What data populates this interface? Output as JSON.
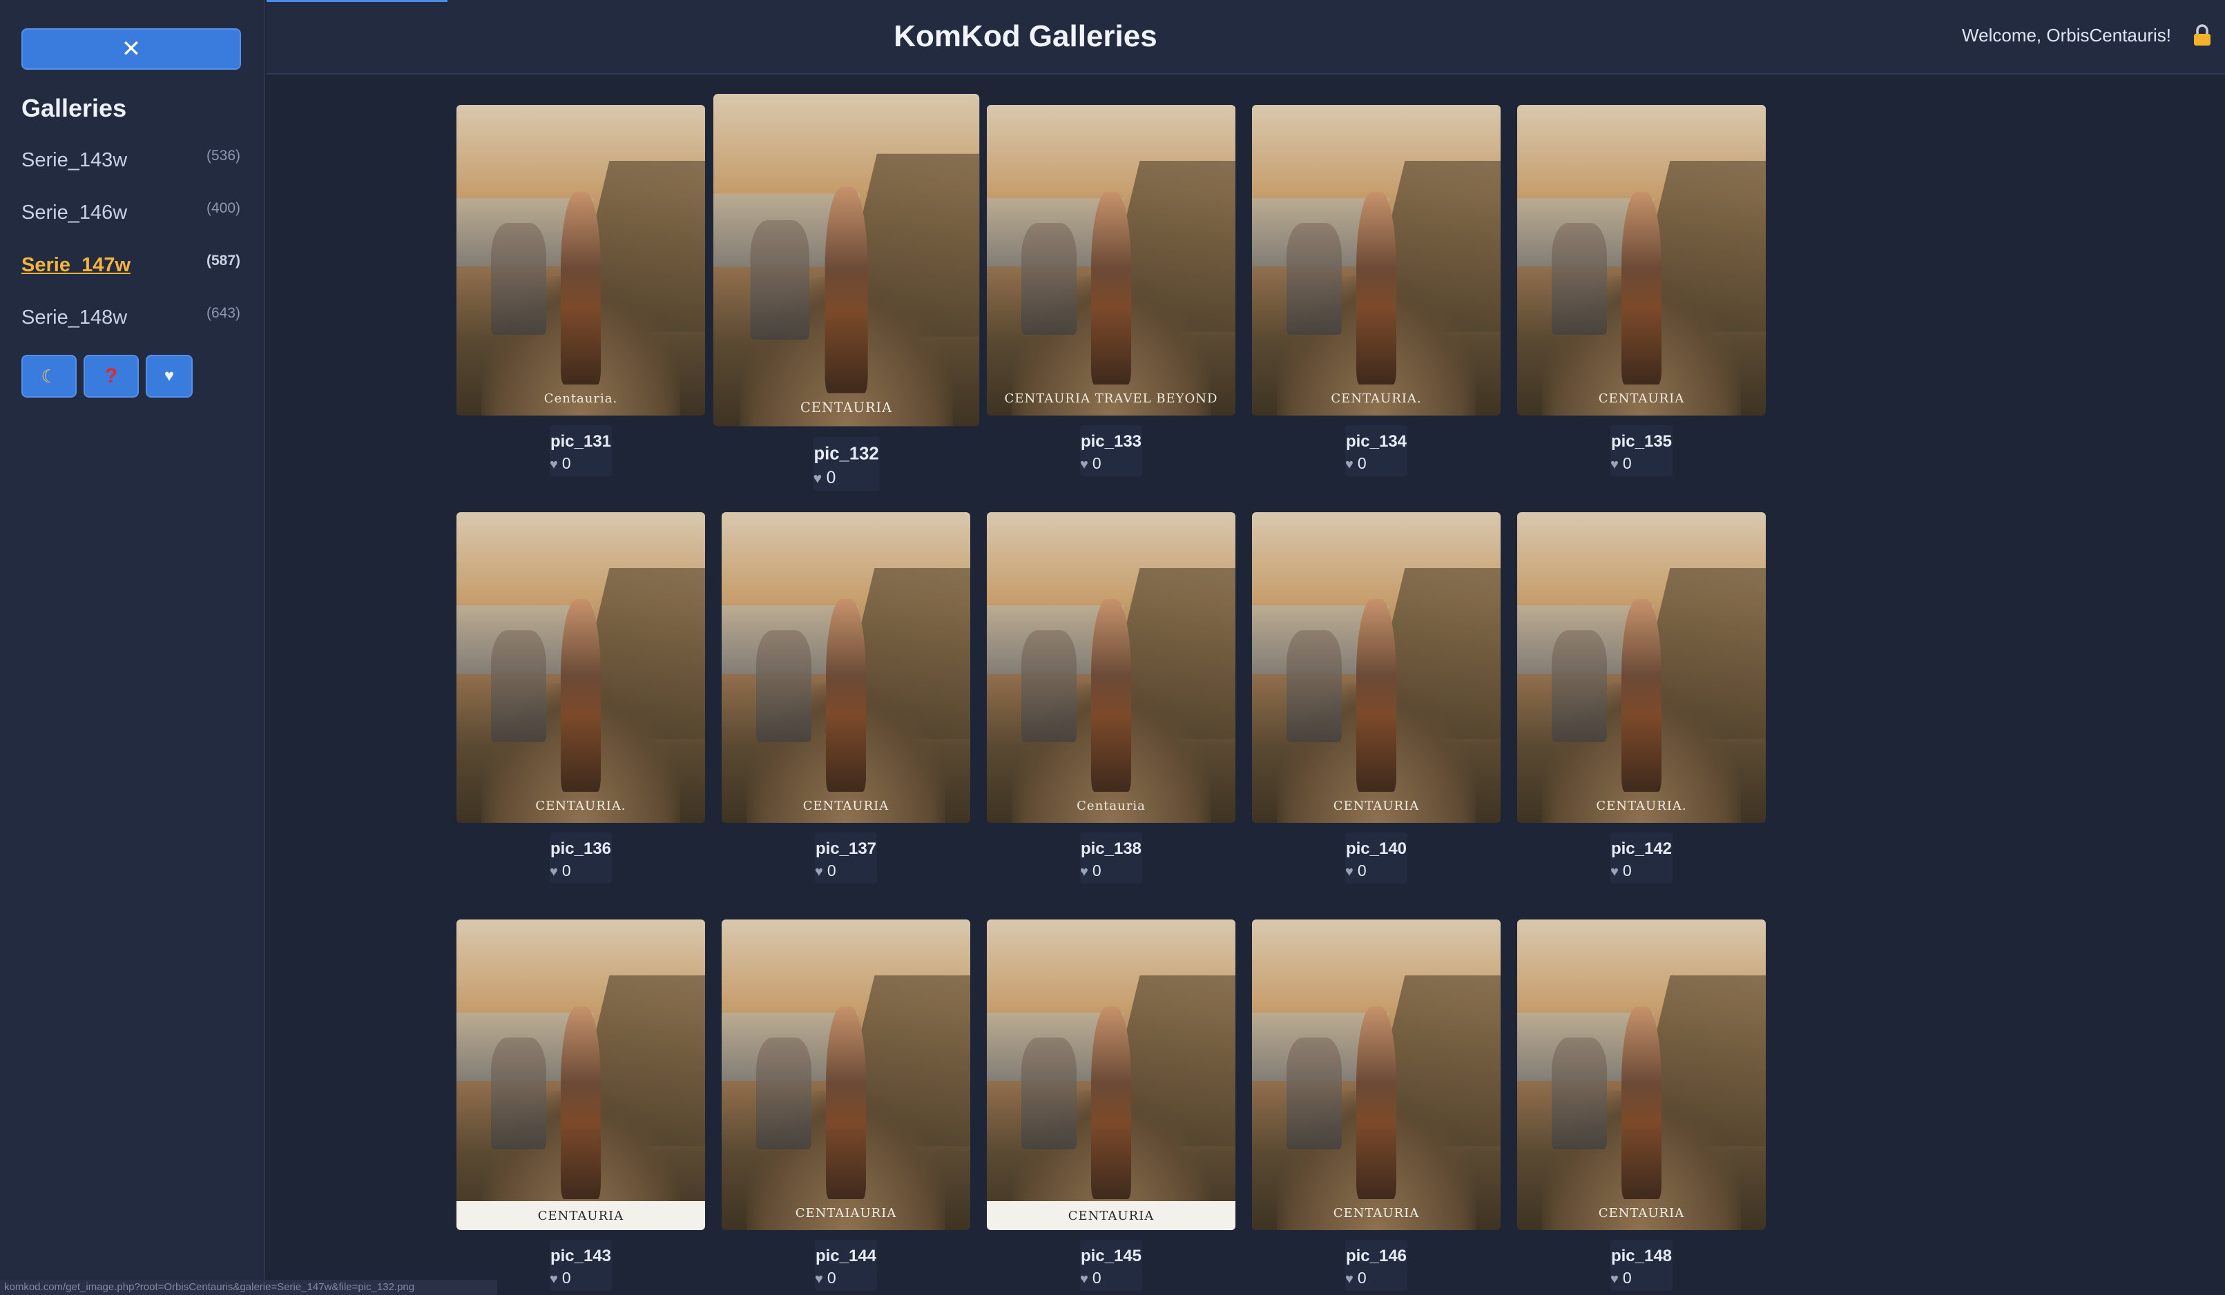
{
  "app": {
    "title": "KomKod Galleries",
    "welcome": "Welcome, OrbisCentauris!"
  },
  "sidebar": {
    "close_label": "✕",
    "title": "Galleries",
    "items": [
      {
        "label": "Serie_143w",
        "count": "(536)",
        "active": false
      },
      {
        "label": "Serie_146w",
        "count": "(400)",
        "active": false
      },
      {
        "label": "Serie_147w",
        "count": "(587)",
        "active": true
      },
      {
        "label": "Serie_148w",
        "count": "(643)",
        "active": false
      }
    ],
    "tools": {
      "theme": "☾",
      "help": "?",
      "favorites": "♥"
    }
  },
  "gallery": {
    "rows": [
      [
        {
          "name": "pic_131",
          "likes": "0",
          "watermark": "Centauria."
        },
        {
          "name": "pic_132",
          "likes": "0",
          "watermark": "CENTAURIA"
        },
        {
          "name": "pic_133",
          "likes": "0",
          "watermark": "CENTAURIA TRAVEL BEYOND"
        },
        {
          "name": "pic_134",
          "likes": "0",
          "watermark": "CENTAURIA."
        },
        {
          "name": "pic_135",
          "likes": "0",
          "watermark": "CENTAURIA"
        }
      ],
      [
        {
          "name": "pic_136",
          "likes": "0",
          "watermark": "CENTAURIA."
        },
        {
          "name": "pic_137",
          "likes": "0",
          "watermark": "CENTAURIA"
        },
        {
          "name": "pic_138",
          "likes": "0",
          "watermark": "Centauria"
        },
        {
          "name": "pic_140",
          "likes": "0",
          "watermark": "CENTAURIA"
        },
        {
          "name": "pic_142",
          "likes": "0",
          "watermark": "CENTAURIA."
        }
      ],
      [
        {
          "name": "pic_143",
          "likes": "0",
          "watermark": "CENTAURIA"
        },
        {
          "name": "pic_144",
          "likes": "0",
          "watermark": "CENTAIAURIA"
        },
        {
          "name": "pic_145",
          "likes": "0",
          "watermark": "CENTAURIA"
        },
        {
          "name": "pic_146",
          "likes": "0",
          "watermark": "CENTAURIA"
        },
        {
          "name": "pic_148",
          "likes": "0",
          "watermark": "CENTAURIA"
        }
      ]
    ]
  },
  "status_url": "komkod.com/get_image.php?root=OrbisCentauris&galerie=Serie_147w&file=pic_132.png",
  "colors": {
    "accent": "#3a7bde",
    "active_link": "#f6b43c",
    "background": "#1e2537"
  }
}
